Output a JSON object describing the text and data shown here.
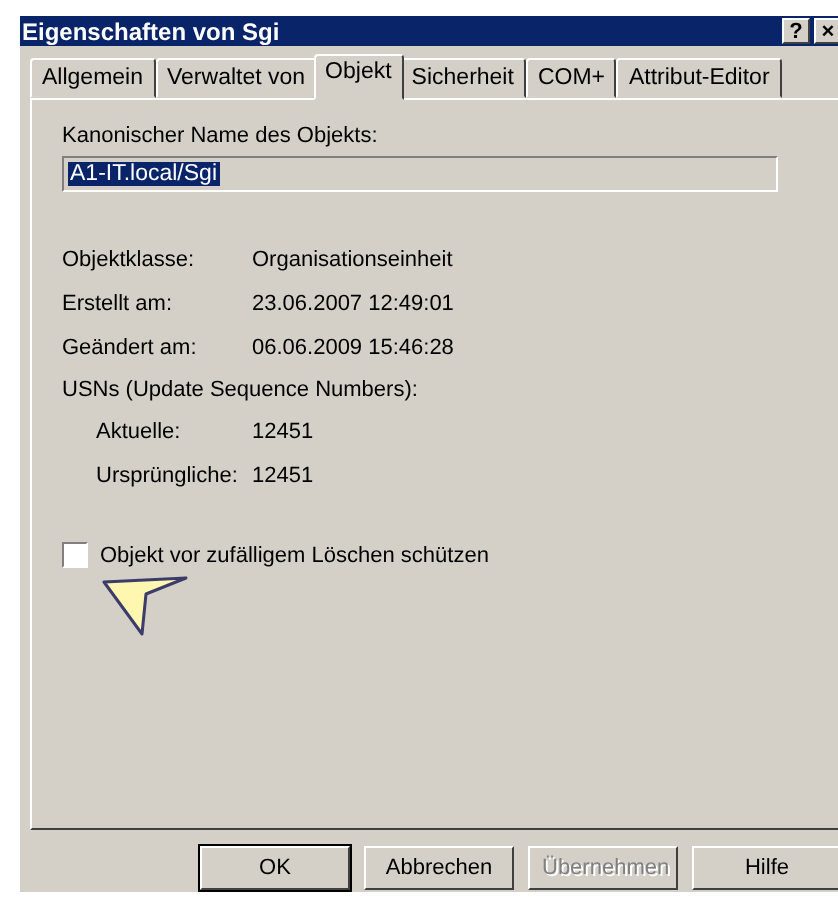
{
  "window": {
    "title": "Eigenschaften von Sgi",
    "title_buttons": [
      "?",
      "×"
    ]
  },
  "tabs": [
    {
      "label": "Allgemein",
      "selected": false
    },
    {
      "label": "Verwaltet von",
      "selected": false
    },
    {
      "label": "Objekt",
      "selected": true
    },
    {
      "label": "Sicherheit",
      "selected": false
    },
    {
      "label": "COM+",
      "selected": false
    },
    {
      "label": "Attribut-Editor",
      "selected": false
    }
  ],
  "canonical_name": {
    "label": "Kanonischer Name des Objekts:",
    "value": "A1-IT.local/Sgi",
    "selected": true
  },
  "details": [
    {
      "label": "Objektklasse:",
      "value": "Organisationseinheit"
    },
    {
      "label": "Erstellt am:",
      "value": "23.06.2007 12:49:01"
    },
    {
      "label": "Geändert am:",
      "value": "06.06.2009 15:46:28"
    }
  ],
  "usns": {
    "label": "USNs (Update Sequence Numbers):",
    "children": [
      {
        "label": "Aktuelle:",
        "value": "12451"
      },
      {
        "label": "Ursprüngliche:",
        "value": "12451"
      }
    ]
  },
  "protect": {
    "label": "Objekt vor zufälligem Löschen schützen",
    "checked": false
  },
  "buttons": [
    {
      "label": "OK",
      "default": true,
      "disabled": false
    },
    {
      "label": "Abbrechen",
      "default": false,
      "disabled": false
    },
    {
      "label": "Übernehmen",
      "default": false,
      "disabled": true
    },
    {
      "label": "Hilfe",
      "default": false,
      "disabled": false
    }
  ]
}
